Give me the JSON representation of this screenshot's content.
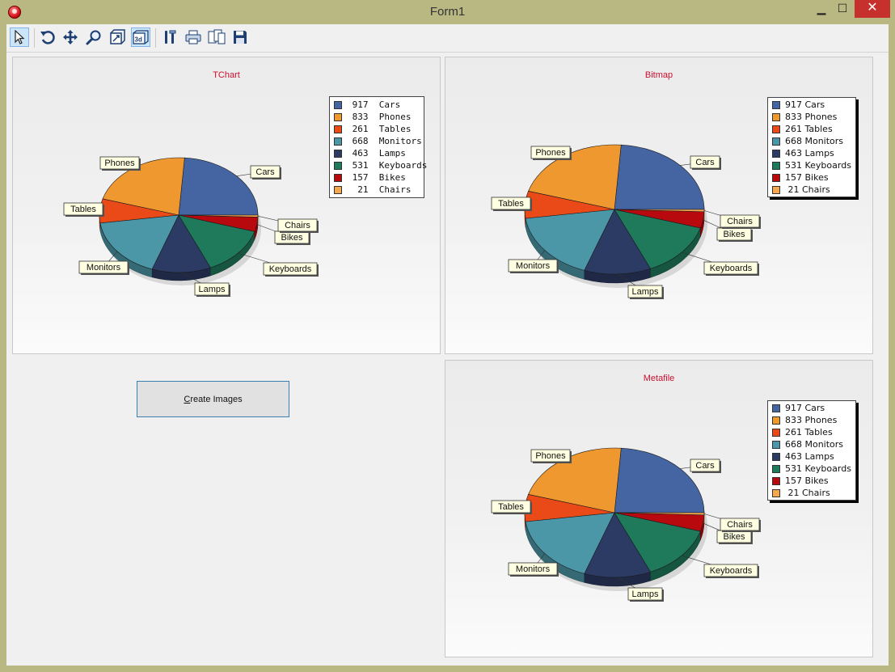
{
  "window": {
    "title": "Form1",
    "minimize": "▁",
    "maximize": "☐",
    "close": "✕"
  },
  "toolbar": {
    "buttons": [
      {
        "name": "pointer-icon",
        "active": true
      },
      {
        "name": "rotate-icon",
        "active": false
      },
      {
        "name": "move-icon",
        "active": false
      },
      {
        "name": "zoom-icon",
        "active": false
      },
      {
        "name": "depth-icon",
        "active": false
      },
      {
        "name": "3d-icon",
        "active": true
      },
      {
        "name": "edit-icon",
        "active": false
      },
      {
        "name": "print-icon",
        "active": false
      },
      {
        "name": "copy-icon",
        "active": false
      },
      {
        "name": "save-icon",
        "active": false
      }
    ]
  },
  "create_button": {
    "label_underlined": "C",
    "label_rest": "reate Images"
  },
  "colors": {
    "Cars": "#4565a2",
    "Phones": "#f09830",
    "Tables": "#ea4a17",
    "Monitors": "#4b97a7",
    "Lamps": "#2c3b64",
    "Keyboards": "#1f7a5c",
    "Bikes": "#b8090f",
    "Chairs": "#f3a74e"
  },
  "chart_data": [
    {
      "type": "pie",
      "title": "TChart",
      "legend_position": "top-right",
      "categories": [
        "Cars",
        "Phones",
        "Tables",
        "Monitors",
        "Lamps",
        "Keyboards",
        "Bikes",
        "Chairs"
      ],
      "values": [
        917,
        833,
        261,
        668,
        463,
        531,
        157,
        21
      ],
      "legend": [
        {
          "value": " 917",
          "label": "Cars"
        },
        {
          "value": " 833",
          "label": "Phones"
        },
        {
          "value": " 261",
          "label": "Tables"
        },
        {
          "value": " 668",
          "label": "Monitors"
        },
        {
          "value": " 463",
          "label": "Lamps"
        },
        {
          "value": " 531",
          "label": "Keyboards"
        },
        {
          "value": " 157",
          "label": "Bikes"
        },
        {
          "value": "  21",
          "label": "Chairs"
        }
      ]
    },
    {
      "type": "pie",
      "title": "Bitmap",
      "legend_position": "top-right",
      "categories": [
        "Cars",
        "Phones",
        "Tables",
        "Monitors",
        "Lamps",
        "Keyboards",
        "Bikes",
        "Chairs"
      ],
      "values": [
        917,
        833,
        261,
        668,
        463,
        531,
        157,
        21
      ],
      "legend": [
        {
          "value": "917",
          "label": "Cars"
        },
        {
          "value": "833",
          "label": "Phones"
        },
        {
          "value": "261",
          "label": "Tables"
        },
        {
          "value": "668",
          "label": "Monitors"
        },
        {
          "value": "463",
          "label": "Lamps"
        },
        {
          "value": "531",
          "label": "Keyboards"
        },
        {
          "value": "157",
          "label": "Bikes"
        },
        {
          "value": " 21",
          "label": "Chairs"
        }
      ]
    },
    {
      "type": "pie",
      "title": "Metafile",
      "legend_position": "top-right",
      "categories": [
        "Cars",
        "Phones",
        "Tables",
        "Monitors",
        "Lamps",
        "Keyboards",
        "Bikes",
        "Chairs"
      ],
      "values": [
        917,
        833,
        261,
        668,
        463,
        531,
        157,
        21
      ],
      "legend": [
        {
          "value": "917",
          "label": "Cars"
        },
        {
          "value": "833",
          "label": "Phones"
        },
        {
          "value": "261",
          "label": "Tables"
        },
        {
          "value": "668",
          "label": "Monitors"
        },
        {
          "value": "463",
          "label": "Lamps"
        },
        {
          "value": "531",
          "label": "Keyboards"
        },
        {
          "value": "157",
          "label": "Bikes"
        },
        {
          "value": " 21",
          "label": "Chairs"
        }
      ]
    }
  ]
}
